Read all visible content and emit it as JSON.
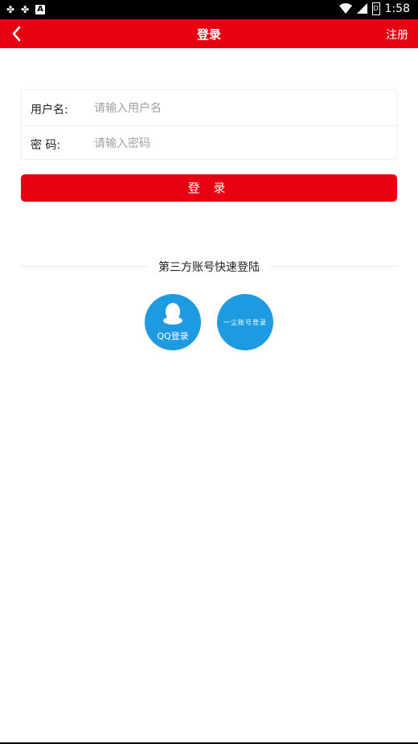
{
  "status_bar": {
    "time": "1:58",
    "notification_a": "A",
    "battery_label": "D"
  },
  "header": {
    "title": "登录",
    "register_label": "注册"
  },
  "form": {
    "username_label": "用户名:",
    "username_placeholder": "请输入用户名",
    "password_label": "密 码:",
    "password_placeholder": "请输入密码"
  },
  "login_button": "登 录",
  "third_party": {
    "title": "第三方账号快速登陆",
    "qq_label": "QQ登录",
    "yichen_label": "一尘账号登录"
  },
  "colors": {
    "primary": "#e60012",
    "social": "#1e9be0"
  }
}
